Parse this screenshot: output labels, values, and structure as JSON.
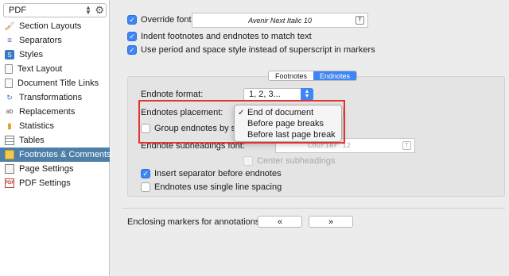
{
  "sidebar": {
    "format": "PDF",
    "items": [
      {
        "label": "Section Layouts",
        "icon": "paintbrush-icon",
        "selected": false
      },
      {
        "label": "Separators",
        "icon": "separator-icon",
        "selected": false
      },
      {
        "label": "Styles",
        "icon": "styles-icon",
        "selected": false
      },
      {
        "label": "Text Layout",
        "icon": "document-icon",
        "selected": false
      },
      {
        "label": "Document Title Links",
        "icon": "document-icon",
        "selected": false
      },
      {
        "label": "Transformations",
        "icon": "transformations-icon",
        "selected": false
      },
      {
        "label": "Replacements",
        "icon": "replacements-icon",
        "selected": false
      },
      {
        "label": "Statistics",
        "icon": "statistics-icon",
        "selected": false
      },
      {
        "label": "Tables",
        "icon": "table-icon",
        "selected": false
      },
      {
        "label": "Footnotes & Comments",
        "icon": "footnote-icon",
        "selected": true
      },
      {
        "label": "Page Settings",
        "icon": "page-icon",
        "selected": false
      },
      {
        "label": "PDF Settings",
        "icon": "pdf-icon",
        "selected": false
      }
    ]
  },
  "main": {
    "override_font_label": "Override font:",
    "override_font_value": "Avenir Next Italic 10",
    "indent_label": "Indent footnotes and endnotes to match text",
    "period_label": "Use period and space style instead of superscript in markers",
    "tabs": [
      "Footnotes",
      "Endnotes"
    ],
    "endnote_format_label": "Endnote format:",
    "endnote_format_value": "1, 2, 3...",
    "placement_label": "Endnotes placement:",
    "placement_options": [
      "End of document",
      "Before page breaks",
      "Before last page break"
    ],
    "group_label": "Group endnotes by sec",
    "subheadings_font_label": "Endnote subheadings font:",
    "subheadings_font_value": "Courier 12",
    "center_subheadings_label": "Center subheadings",
    "insert_separator_label": "Insert separator before endnotes",
    "single_spacing_label": "Endnotes use single line spacing",
    "enclosing_label": "Enclosing markers for annotations:",
    "open_marker": "«",
    "close_marker": "»"
  },
  "colors": {
    "accent": "#3f86f5",
    "selection": "#4d7fa8",
    "highlight": "#e5322f"
  }
}
